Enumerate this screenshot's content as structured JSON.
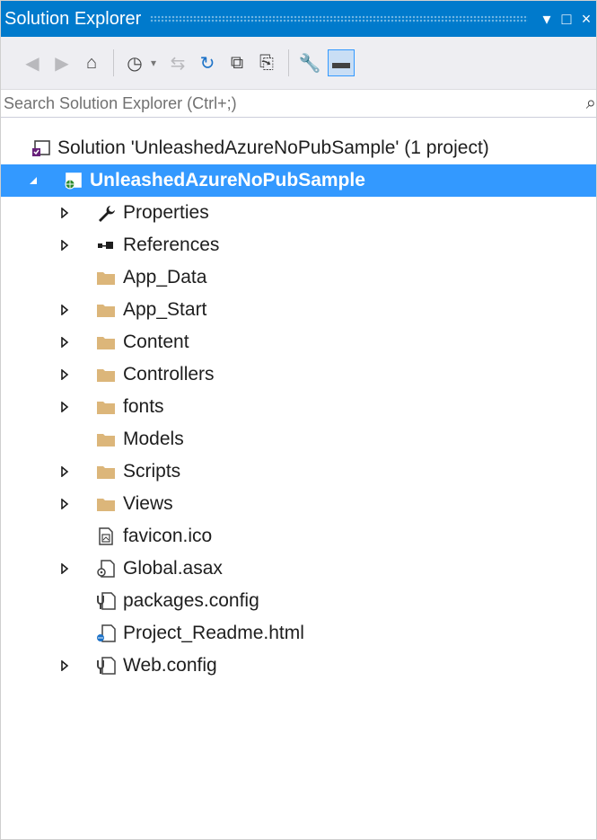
{
  "window": {
    "title": "Solution Explorer",
    "pin_glyph": "▾",
    "maximize_glyph": "□",
    "close_glyph": "×"
  },
  "search": {
    "placeholder": "Search Solution Explorer (Ctrl+;)",
    "value": ""
  },
  "colors": {
    "title_bar": "#007acc",
    "selection": "#3399ff",
    "folder": "#dcb67a",
    "toolbar_bg": "#eeeef2",
    "accent_blue": "#1e73c8"
  },
  "toolbar": {
    "buttons": [
      {
        "name": "back-icon",
        "glyph": "◀",
        "enabled": false
      },
      {
        "name": "forward-icon",
        "glyph": "▶",
        "enabled": false
      },
      {
        "name": "home-icon",
        "glyph": "⌂",
        "enabled": true
      },
      {
        "name": "pending-changes-filter-icon",
        "glyph": "◷",
        "enabled": true
      },
      {
        "name": "sync-with-active-document-icon",
        "glyph": "⇆",
        "enabled": false
      },
      {
        "name": "refresh-icon",
        "glyph": "↻",
        "enabled": true
      },
      {
        "name": "collapse-all-icon",
        "glyph": "⧉",
        "enabled": true
      },
      {
        "name": "show-all-files-icon",
        "glyph": "⎘",
        "enabled": true
      },
      {
        "name": "properties-wrench-icon",
        "glyph": "🔧",
        "enabled": true
      },
      {
        "name": "preview-selected-items-icon",
        "glyph": "▬",
        "enabled": true,
        "pressed": true
      }
    ],
    "dropdown_glyph": "▾",
    "search_glyph": "⌕"
  },
  "tree": {
    "solution": {
      "label": "Solution 'UnleashedAzureNoPubSample' (1 project)",
      "icon": "solution-icon"
    },
    "project": {
      "label": "UnleashedAzureNoPubSample",
      "icon": "web-project-icon",
      "expanded": true,
      "selected": true
    },
    "items": [
      {
        "label": "Properties",
        "icon": "wrench-icon",
        "expandable": true
      },
      {
        "label": "References",
        "icon": "references-icon",
        "expandable": true
      },
      {
        "label": "App_Data",
        "icon": "folder-icon",
        "expandable": false
      },
      {
        "label": "App_Start",
        "icon": "folder-icon",
        "expandable": true
      },
      {
        "label": "Content",
        "icon": "folder-icon",
        "expandable": true
      },
      {
        "label": "Controllers",
        "icon": "folder-icon",
        "expandable": true
      },
      {
        "label": "fonts",
        "icon": "folder-icon",
        "expandable": true
      },
      {
        "label": "Models",
        "icon": "folder-icon",
        "expandable": false
      },
      {
        "label": "Scripts",
        "icon": "folder-icon",
        "expandable": true
      },
      {
        "label": "Views",
        "icon": "folder-icon",
        "expandable": true
      },
      {
        "label": "favicon.ico",
        "icon": "image-file-icon",
        "expandable": false
      },
      {
        "label": "Global.asax",
        "icon": "asax-file-icon",
        "expandable": true
      },
      {
        "label": "packages.config",
        "icon": "config-file-icon",
        "expandable": false
      },
      {
        "label": "Project_Readme.html",
        "icon": "html-file-icon",
        "expandable": false
      },
      {
        "label": "Web.config",
        "icon": "config-file-icon",
        "expandable": true
      }
    ]
  }
}
